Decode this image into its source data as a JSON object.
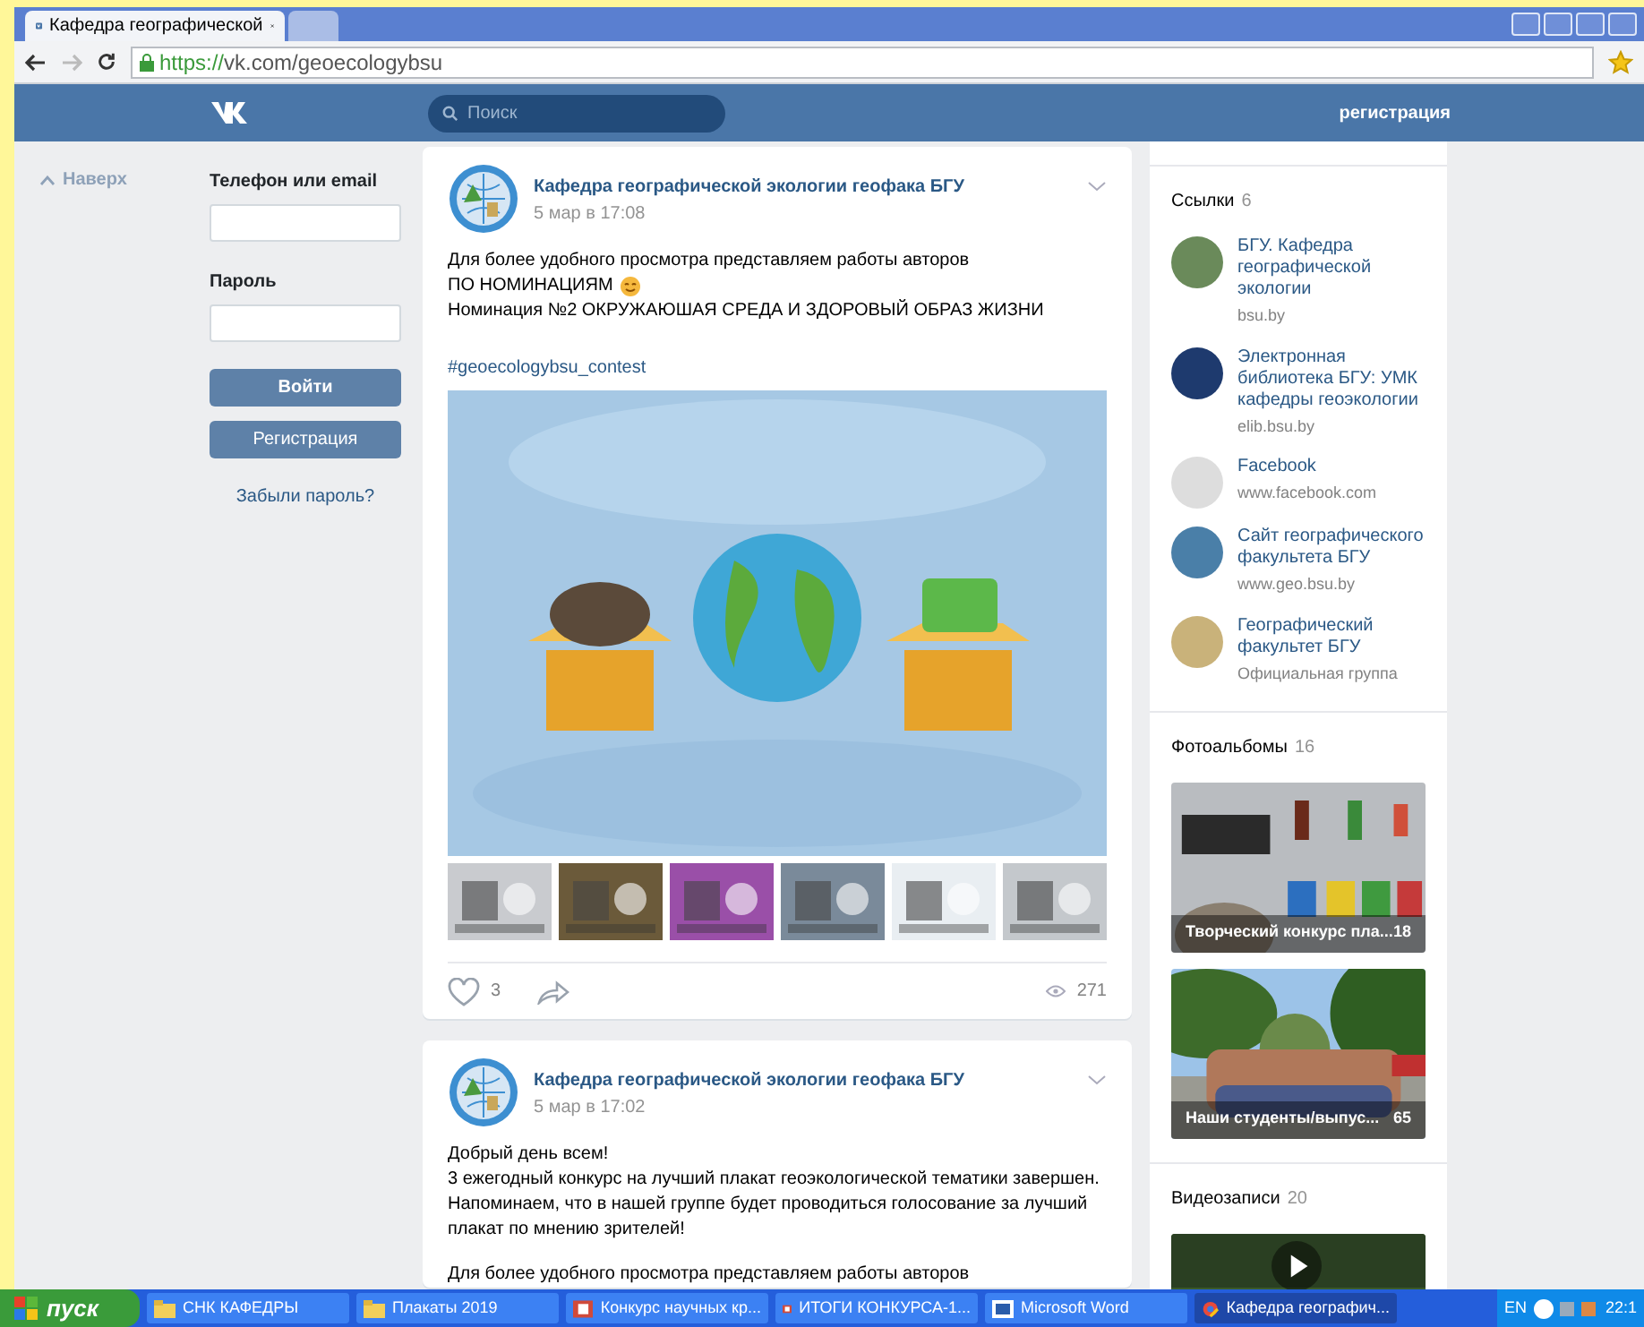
{
  "browser": {
    "tabs": [
      {
        "title": "Кафедра географической",
        "selected": true
      },
      {
        "selected": false
      }
    ],
    "url_scheme": "https://",
    "url_rest": "vk.com/geoecologybsu"
  },
  "header": {
    "search_placeholder": "Поиск",
    "register_link": "регистрация"
  },
  "back_to_top": "Наверх",
  "login": {
    "phone_label": "Телефон или email",
    "password_label": "Пароль",
    "login_button": "Войти",
    "register_button": "Регистрация",
    "forgot_link": "Забыли пароль?"
  },
  "posts": [
    {
      "author": "Кафедра географической экологии геофака БГУ",
      "date": "5 мар в 17:08",
      "blocks": [
        [
          {
            "text": "Для более удобного просмотра представляем работы авторов",
            "emoji": false
          },
          {
            "text": "ПО НОМИНАЦИЯМ",
            "emoji": true
          },
          {
            "text": "Номинация №2 ОКРУЖАЮШАЯ СРЕДА И ЗДОРОВЫЙ ОБРАЗ ЖИЗНИ",
            "emoji": false
          }
        ]
      ],
      "hashtag": "#geoecologybsu_contest",
      "media": {
        "kind": "picture"
      },
      "likes": "3",
      "views": "271"
    },
    {
      "author": "Кафедра географической экологии геофака БГУ",
      "date": "5 мар в 17:02",
      "blocks": [
        [
          {
            "text": "Добрый день всем!",
            "emoji": false
          },
          {
            "text": "3 ежегодный конкурс на лучший плакат геоэкологической тематики завершен.",
            "emoji": false
          },
          {
            "text": "Напоминаем, что в нашей группе будет проводиться голосование за лучший",
            "emoji": false
          },
          {
            "text": "плакат по мнению зрителей!",
            "emoji": false
          }
        ],
        [
          {
            "text": "Для более удобного просмотра представляем работы авторов",
            "emoji": false
          }
        ]
      ]
    }
  ],
  "links": {
    "title": "Ссылки",
    "count": "6",
    "items": [
      {
        "title": "БГУ. Кафедра географической экологии",
        "subtitle": "bsu.by",
        "color": "#6a8a5a"
      },
      {
        "title": "Электронная библиотека БГУ: УМК кафедры геоэкологии",
        "subtitle": "elib.bsu.by",
        "color": "#1e3a6e"
      },
      {
        "title": "Facebook",
        "subtitle": "www.facebook.com",
        "color": "#dddddd"
      },
      {
        "title": "Сайт географического факультета БГУ",
        "subtitle": "www.geo.bsu.by",
        "color": "#4a7fa8"
      },
      {
        "title": "Географический факультет БГУ",
        "subtitle": "Официальная группа",
        "color": "#c9b27a"
      }
    ]
  },
  "albums": {
    "title": "Фотоальбомы",
    "count": "16",
    "items": [
      {
        "title": "Творческий конкурс пла...",
        "count": "18",
        "kind": "poster"
      },
      {
        "title": "Наши студенты/выпус...",
        "count": "65",
        "kind": "outdoor"
      }
    ]
  },
  "videos": {
    "title": "Видеозаписи",
    "count": "20"
  },
  "taskbar": {
    "start": "пуск",
    "items": [
      {
        "label": "СНК КАФЕДРЫ",
        "kind": "folder",
        "selected": false
      },
      {
        "label": "Плакаты 2019",
        "kind": "folder",
        "selected": false
      },
      {
        "label": "Конкурс научных кр...",
        "kind": "doc",
        "selected": false
      },
      {
        "label": "ИТОГИ КОНКУРСА-1...",
        "kind": "doc",
        "selected": false
      },
      {
        "label": "Microsoft Word",
        "kind": "word",
        "selected": false
      },
      {
        "label": "Кафедра географич...",
        "kind": "browser",
        "selected": true
      }
    ],
    "language": "EN",
    "clock": "22:1"
  }
}
